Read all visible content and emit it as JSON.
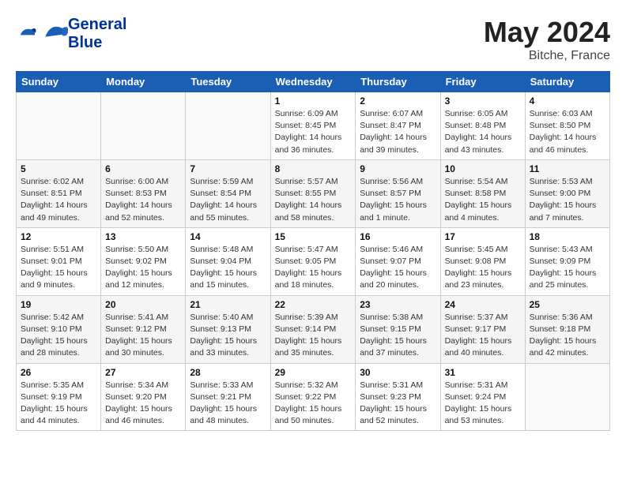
{
  "header": {
    "logo_line1": "General",
    "logo_line2": "Blue",
    "month": "May 2024",
    "location": "Bitche, France"
  },
  "weekdays": [
    "Sunday",
    "Monday",
    "Tuesday",
    "Wednesday",
    "Thursday",
    "Friday",
    "Saturday"
  ],
  "weeks": [
    [
      {
        "day": "",
        "sunrise": "",
        "sunset": "",
        "daylight": ""
      },
      {
        "day": "",
        "sunrise": "",
        "sunset": "",
        "daylight": ""
      },
      {
        "day": "",
        "sunrise": "",
        "sunset": "",
        "daylight": ""
      },
      {
        "day": "1",
        "sunrise": "Sunrise: 6:09 AM",
        "sunset": "Sunset: 8:45 PM",
        "daylight": "Daylight: 14 hours and 36 minutes."
      },
      {
        "day": "2",
        "sunrise": "Sunrise: 6:07 AM",
        "sunset": "Sunset: 8:47 PM",
        "daylight": "Daylight: 14 hours and 39 minutes."
      },
      {
        "day": "3",
        "sunrise": "Sunrise: 6:05 AM",
        "sunset": "Sunset: 8:48 PM",
        "daylight": "Daylight: 14 hours and 43 minutes."
      },
      {
        "day": "4",
        "sunrise": "Sunrise: 6:03 AM",
        "sunset": "Sunset: 8:50 PM",
        "daylight": "Daylight: 14 hours and 46 minutes."
      }
    ],
    [
      {
        "day": "5",
        "sunrise": "Sunrise: 6:02 AM",
        "sunset": "Sunset: 8:51 PM",
        "daylight": "Daylight: 14 hours and 49 minutes."
      },
      {
        "day": "6",
        "sunrise": "Sunrise: 6:00 AM",
        "sunset": "Sunset: 8:53 PM",
        "daylight": "Daylight: 14 hours and 52 minutes."
      },
      {
        "day": "7",
        "sunrise": "Sunrise: 5:59 AM",
        "sunset": "Sunset: 8:54 PM",
        "daylight": "Daylight: 14 hours and 55 minutes."
      },
      {
        "day": "8",
        "sunrise": "Sunrise: 5:57 AM",
        "sunset": "Sunset: 8:55 PM",
        "daylight": "Daylight: 14 hours and 58 minutes."
      },
      {
        "day": "9",
        "sunrise": "Sunrise: 5:56 AM",
        "sunset": "Sunset: 8:57 PM",
        "daylight": "Daylight: 15 hours and 1 minute."
      },
      {
        "day": "10",
        "sunrise": "Sunrise: 5:54 AM",
        "sunset": "Sunset: 8:58 PM",
        "daylight": "Daylight: 15 hours and 4 minutes."
      },
      {
        "day": "11",
        "sunrise": "Sunrise: 5:53 AM",
        "sunset": "Sunset: 9:00 PM",
        "daylight": "Daylight: 15 hours and 7 minutes."
      }
    ],
    [
      {
        "day": "12",
        "sunrise": "Sunrise: 5:51 AM",
        "sunset": "Sunset: 9:01 PM",
        "daylight": "Daylight: 15 hours and 9 minutes."
      },
      {
        "day": "13",
        "sunrise": "Sunrise: 5:50 AM",
        "sunset": "Sunset: 9:02 PM",
        "daylight": "Daylight: 15 hours and 12 minutes."
      },
      {
        "day": "14",
        "sunrise": "Sunrise: 5:48 AM",
        "sunset": "Sunset: 9:04 PM",
        "daylight": "Daylight: 15 hours and 15 minutes."
      },
      {
        "day": "15",
        "sunrise": "Sunrise: 5:47 AM",
        "sunset": "Sunset: 9:05 PM",
        "daylight": "Daylight: 15 hours and 18 minutes."
      },
      {
        "day": "16",
        "sunrise": "Sunrise: 5:46 AM",
        "sunset": "Sunset: 9:07 PM",
        "daylight": "Daylight: 15 hours and 20 minutes."
      },
      {
        "day": "17",
        "sunrise": "Sunrise: 5:45 AM",
        "sunset": "Sunset: 9:08 PM",
        "daylight": "Daylight: 15 hours and 23 minutes."
      },
      {
        "day": "18",
        "sunrise": "Sunrise: 5:43 AM",
        "sunset": "Sunset: 9:09 PM",
        "daylight": "Daylight: 15 hours and 25 minutes."
      }
    ],
    [
      {
        "day": "19",
        "sunrise": "Sunrise: 5:42 AM",
        "sunset": "Sunset: 9:10 PM",
        "daylight": "Daylight: 15 hours and 28 minutes."
      },
      {
        "day": "20",
        "sunrise": "Sunrise: 5:41 AM",
        "sunset": "Sunset: 9:12 PM",
        "daylight": "Daylight: 15 hours and 30 minutes."
      },
      {
        "day": "21",
        "sunrise": "Sunrise: 5:40 AM",
        "sunset": "Sunset: 9:13 PM",
        "daylight": "Daylight: 15 hours and 33 minutes."
      },
      {
        "day": "22",
        "sunrise": "Sunrise: 5:39 AM",
        "sunset": "Sunset: 9:14 PM",
        "daylight": "Daylight: 15 hours and 35 minutes."
      },
      {
        "day": "23",
        "sunrise": "Sunrise: 5:38 AM",
        "sunset": "Sunset: 9:15 PM",
        "daylight": "Daylight: 15 hours and 37 minutes."
      },
      {
        "day": "24",
        "sunrise": "Sunrise: 5:37 AM",
        "sunset": "Sunset: 9:17 PM",
        "daylight": "Daylight: 15 hours and 40 minutes."
      },
      {
        "day": "25",
        "sunrise": "Sunrise: 5:36 AM",
        "sunset": "Sunset: 9:18 PM",
        "daylight": "Daylight: 15 hours and 42 minutes."
      }
    ],
    [
      {
        "day": "26",
        "sunrise": "Sunrise: 5:35 AM",
        "sunset": "Sunset: 9:19 PM",
        "daylight": "Daylight: 15 hours and 44 minutes."
      },
      {
        "day": "27",
        "sunrise": "Sunrise: 5:34 AM",
        "sunset": "Sunset: 9:20 PM",
        "daylight": "Daylight: 15 hours and 46 minutes."
      },
      {
        "day": "28",
        "sunrise": "Sunrise: 5:33 AM",
        "sunset": "Sunset: 9:21 PM",
        "daylight": "Daylight: 15 hours and 48 minutes."
      },
      {
        "day": "29",
        "sunrise": "Sunrise: 5:32 AM",
        "sunset": "Sunset: 9:22 PM",
        "daylight": "Daylight: 15 hours and 50 minutes."
      },
      {
        "day": "30",
        "sunrise": "Sunrise: 5:31 AM",
        "sunset": "Sunset: 9:23 PM",
        "daylight": "Daylight: 15 hours and 52 minutes."
      },
      {
        "day": "31",
        "sunrise": "Sunrise: 5:31 AM",
        "sunset": "Sunset: 9:24 PM",
        "daylight": "Daylight: 15 hours and 53 minutes."
      },
      {
        "day": "",
        "sunrise": "",
        "sunset": "",
        "daylight": ""
      }
    ]
  ]
}
